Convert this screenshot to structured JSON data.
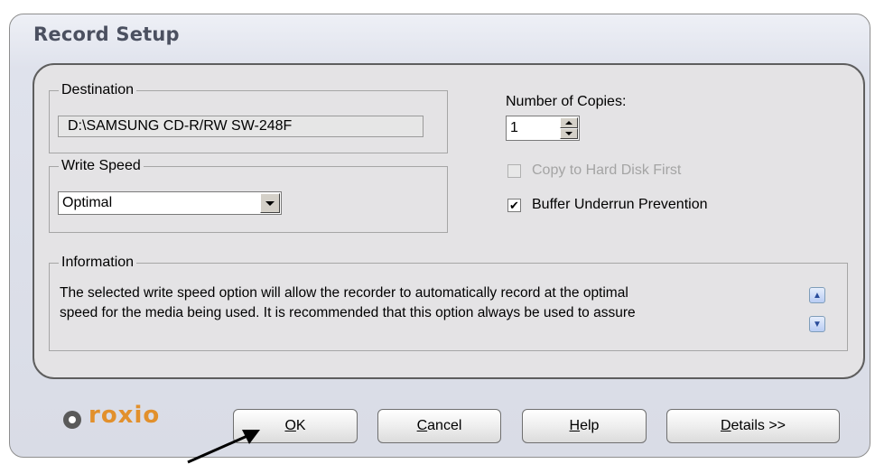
{
  "window": {
    "title": "Record Setup"
  },
  "destination": {
    "legend": "Destination",
    "value": "D:\\SAMSUNG CD-R/RW SW-248F"
  },
  "write_speed": {
    "legend": "Write Speed",
    "selected": "Optimal"
  },
  "copies": {
    "label": "Number of Copies:",
    "value": "1"
  },
  "options": {
    "copy_to_hard_disk": {
      "label": "Copy to Hard Disk First",
      "checked": false,
      "enabled": false
    },
    "buffer_underrun": {
      "label": "Buffer Underrun Prevention",
      "checked": true,
      "enabled": true,
      "check_glyph": "✔"
    }
  },
  "information": {
    "legend": "Information",
    "line1": "The selected write speed option will allow the recorder to automatically record at the optimal",
    "line2": "speed for the media being used. It is recommended that this option always be used to assure"
  },
  "brand": {
    "logo_text": "roxio",
    "accent_color": "#e2902c"
  },
  "buttons": {
    "ok": {
      "mnemonic": "O",
      "rest": "K"
    },
    "cancel": {
      "mnemonic": "C",
      "rest": "ancel"
    },
    "help": {
      "mnemonic": "H",
      "rest": "elp"
    },
    "details": {
      "mnemonic": "D",
      "rest": "etails >>"
    }
  },
  "icons": {
    "scroll_up": "chevron-up-icon",
    "scroll_down": "chevron-down-icon",
    "combo_arrow": "dropdown-arrow-icon",
    "annotation": "pointer-arrow-icon"
  }
}
